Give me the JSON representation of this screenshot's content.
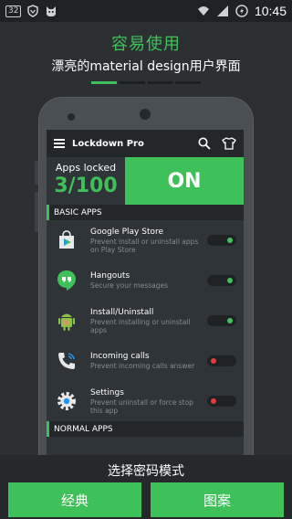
{
  "statusbar": {
    "notification_badge": "32",
    "time": "10:45",
    "icons": [
      "notification-count-icon",
      "shield-icon",
      "cat-icon",
      "wifi-icon",
      "signal-icon",
      "battery-charging-icon"
    ]
  },
  "headline": "容易使用",
  "subline": "漂亮的material design用户界面",
  "pager": {
    "count": 4,
    "active_index": 0
  },
  "preview": {
    "app_title": "Lockdown Pro",
    "apps_locked_label": "Apps locked",
    "apps_locked_count": "3/100",
    "master_toggle": "ON",
    "sections": {
      "basic": "BASIC APPS",
      "normal": "NORMAL APPS"
    },
    "apps": [
      {
        "name": "Google Play Store",
        "desc": "Prevent install or uninstall apps on Play Store",
        "icon": "play-store-icon",
        "locked": true
      },
      {
        "name": "Hangouts",
        "desc": "Secure your messages",
        "icon": "hangouts-icon",
        "locked": true
      },
      {
        "name": "Install/Uninstall",
        "desc": "Prevent installing or uninstall apps",
        "icon": "android-installer-icon",
        "locked": true
      },
      {
        "name": "Incoming calls",
        "desc": "Prevent incoming calls answer",
        "icon": "phone-icon",
        "locked": false
      },
      {
        "name": "Settings",
        "desc": "Prevent uninstall or force stop this app",
        "icon": "settings-gear-icon",
        "locked": false
      }
    ]
  },
  "bottom": {
    "title": "选择密码模式",
    "btn_classic": "经典",
    "btn_pattern": "图案"
  },
  "colors": {
    "accent": "#3ec159",
    "background": "#2d3033",
    "toggle_off_knob": "#e23b3b"
  }
}
